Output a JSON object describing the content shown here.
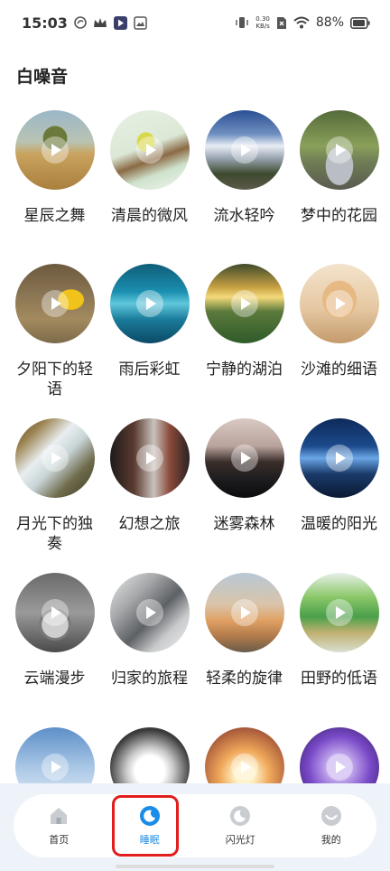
{
  "status_bar": {
    "time": "15:03",
    "network_speed_value": "0.30",
    "network_speed_unit": "KB/s",
    "battery": "88%"
  },
  "page": {
    "title": "白噪音"
  },
  "sounds": [
    {
      "label": "星辰之舞",
      "icon": "photo-field-tree"
    },
    {
      "label": "清晨的微风",
      "icon": "photo-bird"
    },
    {
      "label": "流水轻吟",
      "icon": "photo-train"
    },
    {
      "label": "梦中的花园",
      "icon": "photo-car"
    },
    {
      "label": "夕阳下的轻语",
      "icon": "photo-child-raincoat"
    },
    {
      "label": "雨后彩虹",
      "icon": "photo-swimmer"
    },
    {
      "label": "宁静的湖泊",
      "icon": "photo-lake-sunset"
    },
    {
      "label": "沙滩的细语",
      "icon": "photo-cat"
    },
    {
      "label": "月光下的独奏",
      "icon": "photo-waterfall"
    },
    {
      "label": "幻想之旅",
      "icon": "photo-car-interior"
    },
    {
      "label": "迷雾森林",
      "icon": "photo-piano-girl"
    },
    {
      "label": "温暖的阳光",
      "icon": "photo-lightning"
    },
    {
      "label": "云端漫步",
      "icon": "photo-pocket-watch"
    },
    {
      "label": "归家的旅程",
      "icon": "photo-engine"
    },
    {
      "label": "轻柔的旋律",
      "icon": "photo-girl-beach"
    },
    {
      "label": "田野的低语",
      "icon": "photo-frog-leaf"
    },
    {
      "label": "",
      "icon": "photo-sky-clouds"
    },
    {
      "label": "",
      "icon": "photo-motorbike"
    },
    {
      "label": "",
      "icon": "photo-sunset-person"
    },
    {
      "label": "",
      "icon": "photo-purple-sky"
    }
  ],
  "bottom_nav": {
    "items": [
      {
        "label": "首页",
        "icon": "home-icon"
      },
      {
        "label": "睡眠",
        "icon": "sleep-moon-icon",
        "active": true
      },
      {
        "label": "闪光灯",
        "icon": "flashlight-icon"
      },
      {
        "label": "我的",
        "icon": "profile-icon"
      }
    ]
  },
  "colors": {
    "accent": "#1a8de8",
    "highlight": "#e11d1d",
    "nav_background": "#eef3f9"
  }
}
